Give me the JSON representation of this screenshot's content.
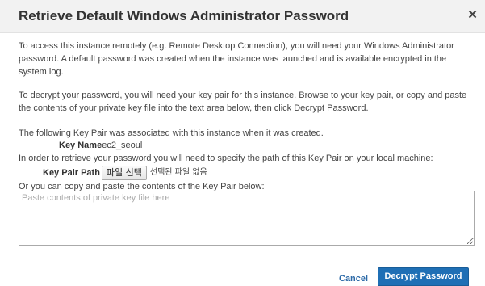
{
  "dialog": {
    "title": "Retrieve Default Windows Administrator Password",
    "close_glyph": "×",
    "close_icon": "close-icon"
  },
  "body": {
    "intro": "To access this instance remotely (e.g. Remote Desktop Connection), you will need your Windows Administrator password. A default password was created when the instance was launched and is available encrypted in the system log.",
    "decrypt_instructions": "To decrypt your password, you will need your key pair for this instance. Browse to your key pair, or copy and paste the contents of your private key file into the text area below, then click Decrypt Password.",
    "associated_note": "The following Key Pair was associated with this instance when it was created.",
    "key_name_label": "Key Name",
    "key_name_value": "ec2_seoul",
    "retrieve_note": "In order to retrieve your password you will need to specify the path of this Key Pair on your local machine:",
    "key_pair_path_label": "Key Pair Path",
    "file_button_label": "파일 선택",
    "no_file_text": "선택된 파일 없음",
    "copy_paste_note": "Or you can copy and paste the contents of the Key Pair below:",
    "textarea_placeholder": "Paste contents of private key file here",
    "textarea_value": ""
  },
  "footer": {
    "cancel_label": "Cancel",
    "decrypt_button_label": "Decrypt Password"
  },
  "colors": {
    "header_bg": "#f2f2f2",
    "primary_button": "#1f6fb5",
    "link": "#2e6ba8",
    "text": "#444444"
  }
}
